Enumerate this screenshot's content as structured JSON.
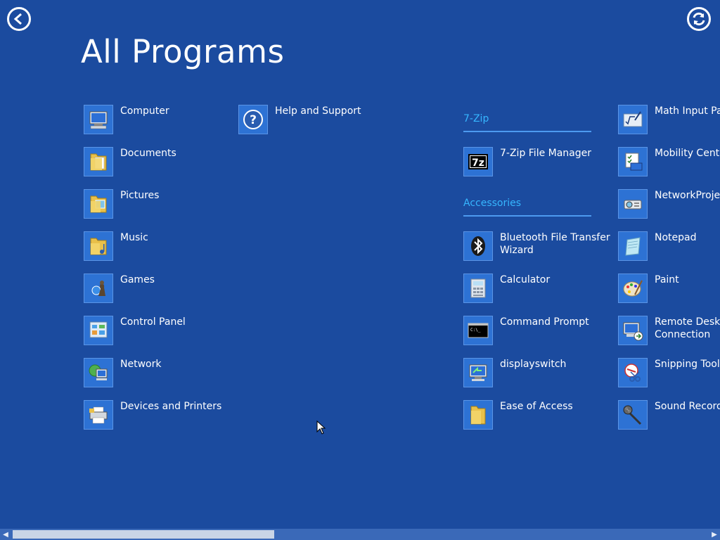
{
  "header": {
    "title": "All Programs"
  },
  "columns": [
    {
      "items": [
        {
          "name": "computer",
          "label": "Computer",
          "icon": "computer-icon"
        },
        {
          "name": "documents",
          "label": "Documents",
          "icon": "documents-folder-icon"
        },
        {
          "name": "pictures",
          "label": "Pictures",
          "icon": "pictures-folder-icon"
        },
        {
          "name": "music",
          "label": "Music",
          "icon": "music-folder-icon"
        },
        {
          "name": "games",
          "label": "Games",
          "icon": "games-icon"
        },
        {
          "name": "control-panel",
          "label": "Control Panel",
          "icon": "control-panel-icon"
        },
        {
          "name": "network",
          "label": "Network",
          "icon": "network-icon"
        },
        {
          "name": "devices-printers",
          "label": "Devices and Printers",
          "icon": "printer-icon"
        }
      ]
    },
    {
      "items": [
        {
          "name": "help-support",
          "label": "Help and Support",
          "icon": "help-icon"
        }
      ]
    }
  ],
  "groups": {
    "sevenzip": {
      "header": "7-Zip",
      "items": [
        {
          "name": "7zip-file-manager",
          "label": "7-Zip File Manager",
          "icon": "7zip-icon"
        }
      ]
    },
    "accessories": {
      "header": "Accessories",
      "items": [
        {
          "name": "bluetooth",
          "label": "Bluetooth File Transfer Wizard",
          "icon": "bluetooth-icon"
        },
        {
          "name": "calculator",
          "label": "Calculator",
          "icon": "calculator-icon"
        },
        {
          "name": "command-prompt",
          "label": "Command Prompt",
          "icon": "command-prompt-icon"
        },
        {
          "name": "displayswitch",
          "label": "displayswitch",
          "icon": "display-switch-icon"
        },
        {
          "name": "ease-of-access",
          "label": "Ease of Access",
          "icon": "folder-icon"
        }
      ]
    },
    "right": {
      "items": [
        {
          "name": "math-input",
          "label": "Math Input Pa",
          "icon": "math-input-icon"
        },
        {
          "name": "mobility-center",
          "label": "Mobility Center",
          "icon": "mobility-center-icon"
        },
        {
          "name": "network-projector",
          "label": "NetworkProjec",
          "icon": "network-projector-icon"
        },
        {
          "name": "notepad",
          "label": "Notepad",
          "icon": "notepad-icon"
        },
        {
          "name": "paint",
          "label": "Paint",
          "icon": "paint-icon"
        },
        {
          "name": "remote-desktop",
          "label": "Remote Deskt Connection",
          "icon": "remote-desktop-icon"
        },
        {
          "name": "snipping-tool",
          "label": "Snipping Tool",
          "icon": "snipping-tool-icon"
        },
        {
          "name": "sound-recorder",
          "label": "Sound Recorde",
          "icon": "microphone-icon"
        }
      ]
    }
  },
  "colors": {
    "background": "#1b4b9f",
    "tile": "#2d72d4",
    "group_header": "#36b6ff"
  },
  "scrollbar": {
    "position": 0
  }
}
